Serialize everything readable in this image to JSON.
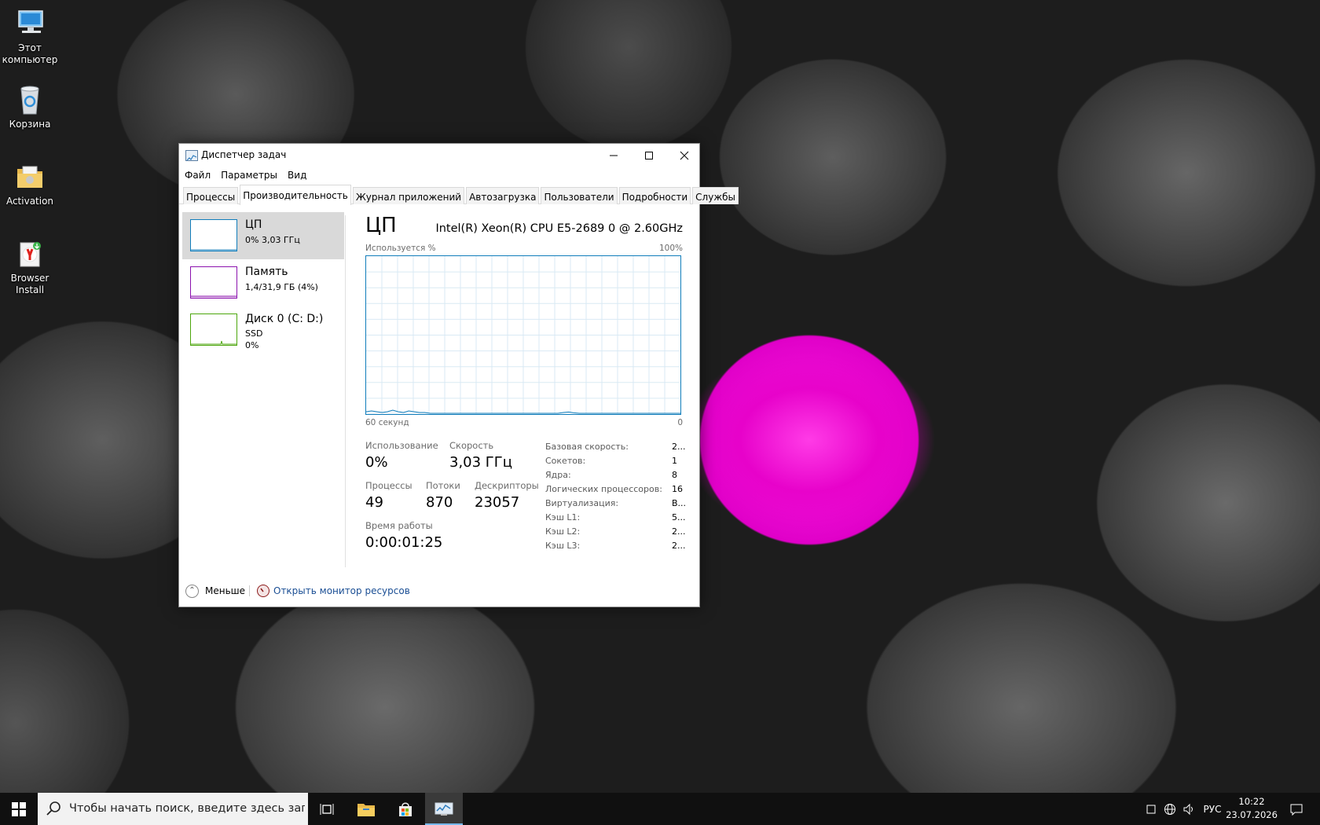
{
  "desktop": {
    "icons": [
      {
        "label_line1": "Этот",
        "label_line2": "компьютер",
        "icon": "this-pc-icon"
      },
      {
        "label_line1": "Корзина",
        "label_line2": "",
        "icon": "recycle-bin-icon"
      },
      {
        "label_line1": "Activation",
        "label_line2": "",
        "icon": "folder-icon"
      },
      {
        "label_line1": "Browser",
        "label_line2": "Install",
        "icon": "yandex-browser-icon"
      }
    ]
  },
  "window": {
    "title": "Диспетчер задач",
    "controls": {
      "minimize": "—",
      "maximize": "☐",
      "close": "✕"
    }
  },
  "menu": [
    "Файл",
    "Параметры",
    "Вид"
  ],
  "tabs": [
    "Процессы",
    "Производительность",
    "Журнал приложений",
    "Автозагрузка",
    "Пользователи",
    "Подробности",
    "Службы"
  ],
  "active_tab": "Производительность",
  "sidebar": {
    "items": [
      {
        "name": "ЦП",
        "line1": "0% 3,03 ГГц",
        "line2": "",
        "color": "#117dbb",
        "selected": true
      },
      {
        "name": "Память",
        "line1": "1,4/31,9 ГБ (4%)",
        "line2": "",
        "color": "#8b12ae",
        "selected": false
      },
      {
        "name": "Диск 0 (C: D:)",
        "line1": "SSD",
        "line2": "0%",
        "color": "#4da60c",
        "selected": false
      }
    ]
  },
  "cpu": {
    "title": "ЦП",
    "model": "Intel(R) Xeon(R) CPU E5-2689 0 @ 2.60GHz",
    "graph": {
      "top_left": "Используется %",
      "top_right": "100%",
      "bottom_left": "60 секунд",
      "bottom_right": "0",
      "usage_percent_history": [
        1,
        1.5,
        1,
        0.5,
        1,
        2,
        1,
        0.5,
        1.5,
        1,
        0.5,
        0.5,
        0,
        0,
        0,
        0,
        0,
        0,
        0,
        0,
        0,
        0,
        0,
        0,
        0,
        0,
        0,
        0,
        0,
        0,
        0,
        0,
        0,
        0,
        0,
        0,
        0,
        0.5,
        0.8,
        0.3,
        0,
        0,
        0,
        0,
        0,
        0,
        0,
        0,
        0,
        0,
        0,
        0,
        0,
        0,
        0,
        0,
        0,
        0,
        0,
        0
      ]
    },
    "stats": {
      "usage_label": "Использование",
      "usage_value": "0%",
      "speed_label": "Скорость",
      "speed_value": "3,03 ГГц",
      "processes_label": "Процессы",
      "processes_value": "49",
      "threads_label": "Потоки",
      "threads_value": "870",
      "handles_label": "Дескрипторы",
      "handles_value": "23057",
      "uptime_label": "Время работы",
      "uptime_value": "0:00:01:25"
    },
    "specs": [
      {
        "key": "Базовая скорость:",
        "value": "2..."
      },
      {
        "key": "Сокетов:",
        "value": "1"
      },
      {
        "key": "Ядра:",
        "value": "8"
      },
      {
        "key": "Логических процессоров:",
        "value": "16"
      },
      {
        "key": "Виртуализация:",
        "value": "В..."
      },
      {
        "key": "Кэш L1:",
        "value": "5..."
      },
      {
        "key": "Кэш L2:",
        "value": "2..."
      },
      {
        "key": "Кэш L3:",
        "value": "2..."
      }
    ]
  },
  "footer": {
    "less_label": "Меньше",
    "resource_monitor_label": "Открыть монитор ресурсов"
  },
  "taskbar": {
    "search_placeholder": "Чтобы начать поиск, введите здесь запрос",
    "apps": [
      "task-view-icon",
      "file-explorer-icon",
      "store-icon",
      "task-manager-icon"
    ],
    "language": "РУС",
    "time": "10:22",
    "date": "23.07.2026"
  }
}
